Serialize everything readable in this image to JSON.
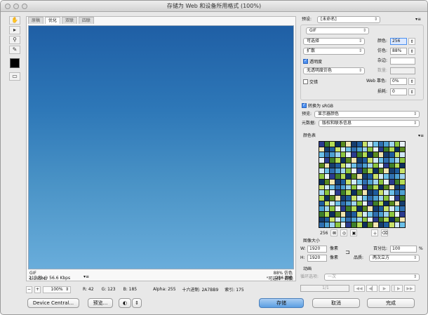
{
  "window": {
    "title": "存储为 Web 和设备所用格式 (100%)"
  },
  "tabs": [
    "原稿",
    "优化",
    "双联",
    "四联"
  ],
  "active_tab": 1,
  "info": {
    "format": "GIF",
    "size": "1.165M",
    "time": "217 秒 @ 56.6 Kbps",
    "dither": "88% 仿色",
    "palette": "\"可选择\" 调板",
    "colors": "256 颜色"
  },
  "status": {
    "zoom": "100%",
    "r": "R: 42",
    "g": "G: 123",
    "b": "B: 185",
    "alpha": "Alpha: 255",
    "hex": "十六进制: 2A7BB9",
    "index": "索引: 175"
  },
  "buttons": {
    "device_central": "Device Central...",
    "preview": "预览...",
    "save": "存储",
    "cancel": "取消",
    "done": "完成"
  },
  "right": {
    "preset_label": "预设:",
    "preset": "[未命名]",
    "format": "GIF",
    "reduction": "可选择",
    "colors_label": "颜色:",
    "colors": "256",
    "dither_algo": "扩散",
    "dither_label": "仿色:",
    "dither": "88%",
    "transparency": "透明度",
    "matte_label": "杂边:",
    "trans_dither": "无透明度仿色",
    "amount_label": "数量:",
    "interlaced": "交错",
    "web_snap_label": "Web 靠色:",
    "web_snap": "0%",
    "lossy_label": "损耗:",
    "lossy": "0",
    "convert_srgb": "转换为 sRGB",
    "preview_label": "预览:",
    "preview": "显示器颜色",
    "metadata_label": "元数据:",
    "metadata": "版权和联系信息",
    "color_table": "颜色表",
    "color_count": "256",
    "image_size": "图像大小",
    "w_label": "W:",
    "w": "1920",
    "h_label": "H:",
    "h": "1920",
    "px": "像素",
    "percent_label": "百分比:",
    "percent": "100",
    "percent_unit": "%",
    "quality_label": "品质:",
    "quality": "两次立方",
    "animation": "动画",
    "loop_label": "循环选项:",
    "loop": "一次",
    "frame": "1/1"
  },
  "palette_colors": [
    "#2b3b8f",
    "#1e5c9e",
    "#8cc63f",
    "#f2e6b1",
    "#4ea1d3",
    "#0d2f5e",
    "#6cc0e8",
    "#3f7f2a",
    "#c9e26a",
    "#e8f1f7",
    "#163d6e",
    "#9fd3ef",
    "#5a8a1f",
    "#2f6fb0",
    "#b4dc55",
    "#d1e9f6"
  ]
}
